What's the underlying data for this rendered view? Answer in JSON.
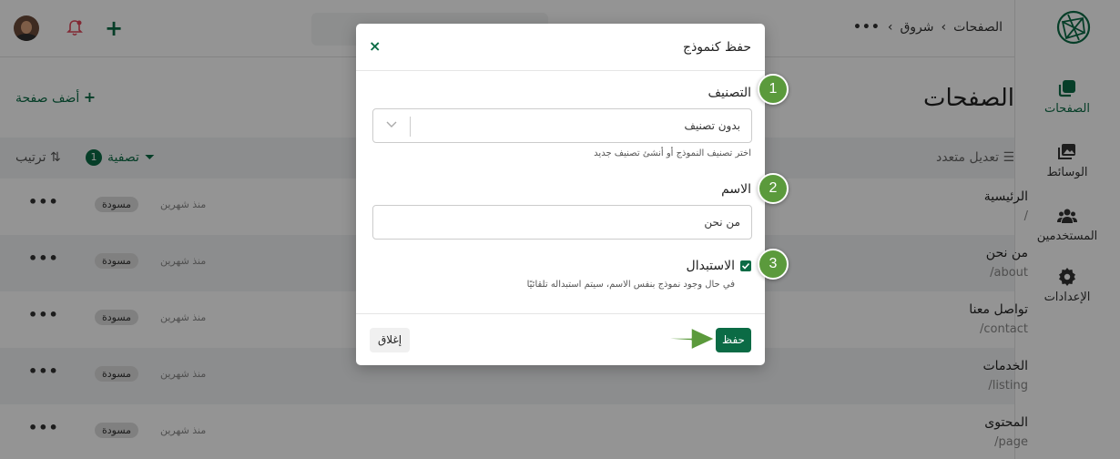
{
  "sidebar": {
    "items": [
      {
        "label": "الصفحات",
        "icon": "pages-icon"
      },
      {
        "label": "الوسائط",
        "icon": "media-icon"
      },
      {
        "label": "المستخدمين",
        "icon": "users-icon"
      },
      {
        "label": "الإعدادات",
        "icon": "settings-icon"
      }
    ],
    "logo": "brand-logo-icon"
  },
  "topbar": {
    "breadcrumb": {
      "dots": "•••",
      "site": "شروق",
      "page": "الصفحات"
    }
  },
  "main": {
    "title": "الصفحات",
    "add_page": "أضف صفحة",
    "bulk_edit": "تعديل متعدد",
    "filter": "تصفية",
    "filter_count": "1",
    "sort": "ترتيب",
    "rows": [
      {
        "title": "الرئيسية",
        "slug": "/",
        "time": "منذ شهرين",
        "status": "مسودة"
      },
      {
        "title": "من نحن",
        "slug": "/about",
        "time": "منذ شهرين",
        "status": "مسودة"
      },
      {
        "title": "تواصل معنا",
        "slug": "/contact",
        "time": "منذ شهرين",
        "status": "مسودة"
      },
      {
        "title": "الخدمات",
        "slug": "/listing",
        "time": "منذ شهرين",
        "status": "مسودة"
      },
      {
        "title": "المحتوى",
        "slug": "/page",
        "time": "منذ شهرين",
        "status": "مسودة"
      }
    ],
    "more": "•••"
  },
  "modal": {
    "title": "حفظ كنموذج",
    "close_icon": "×",
    "category_label": "التصنيف",
    "category_value": "بدون تصنيف",
    "category_help": "اختر تصنيف النموذج أو أنشئ تصنيف جديد",
    "name_label": "الاسم",
    "name_value": "من نحن",
    "replace_label": "الاستبدال",
    "replace_checked": true,
    "replace_help": "في حال وجود نموذج بنفس الاسم، سيتم استبداله تلقائيًا",
    "save_label": "حفظ",
    "close_label": "إغلاق"
  },
  "steps": [
    "1",
    "2",
    "3"
  ],
  "colors": {
    "brand": "#0b6b45",
    "step": "#5b9a3c"
  }
}
